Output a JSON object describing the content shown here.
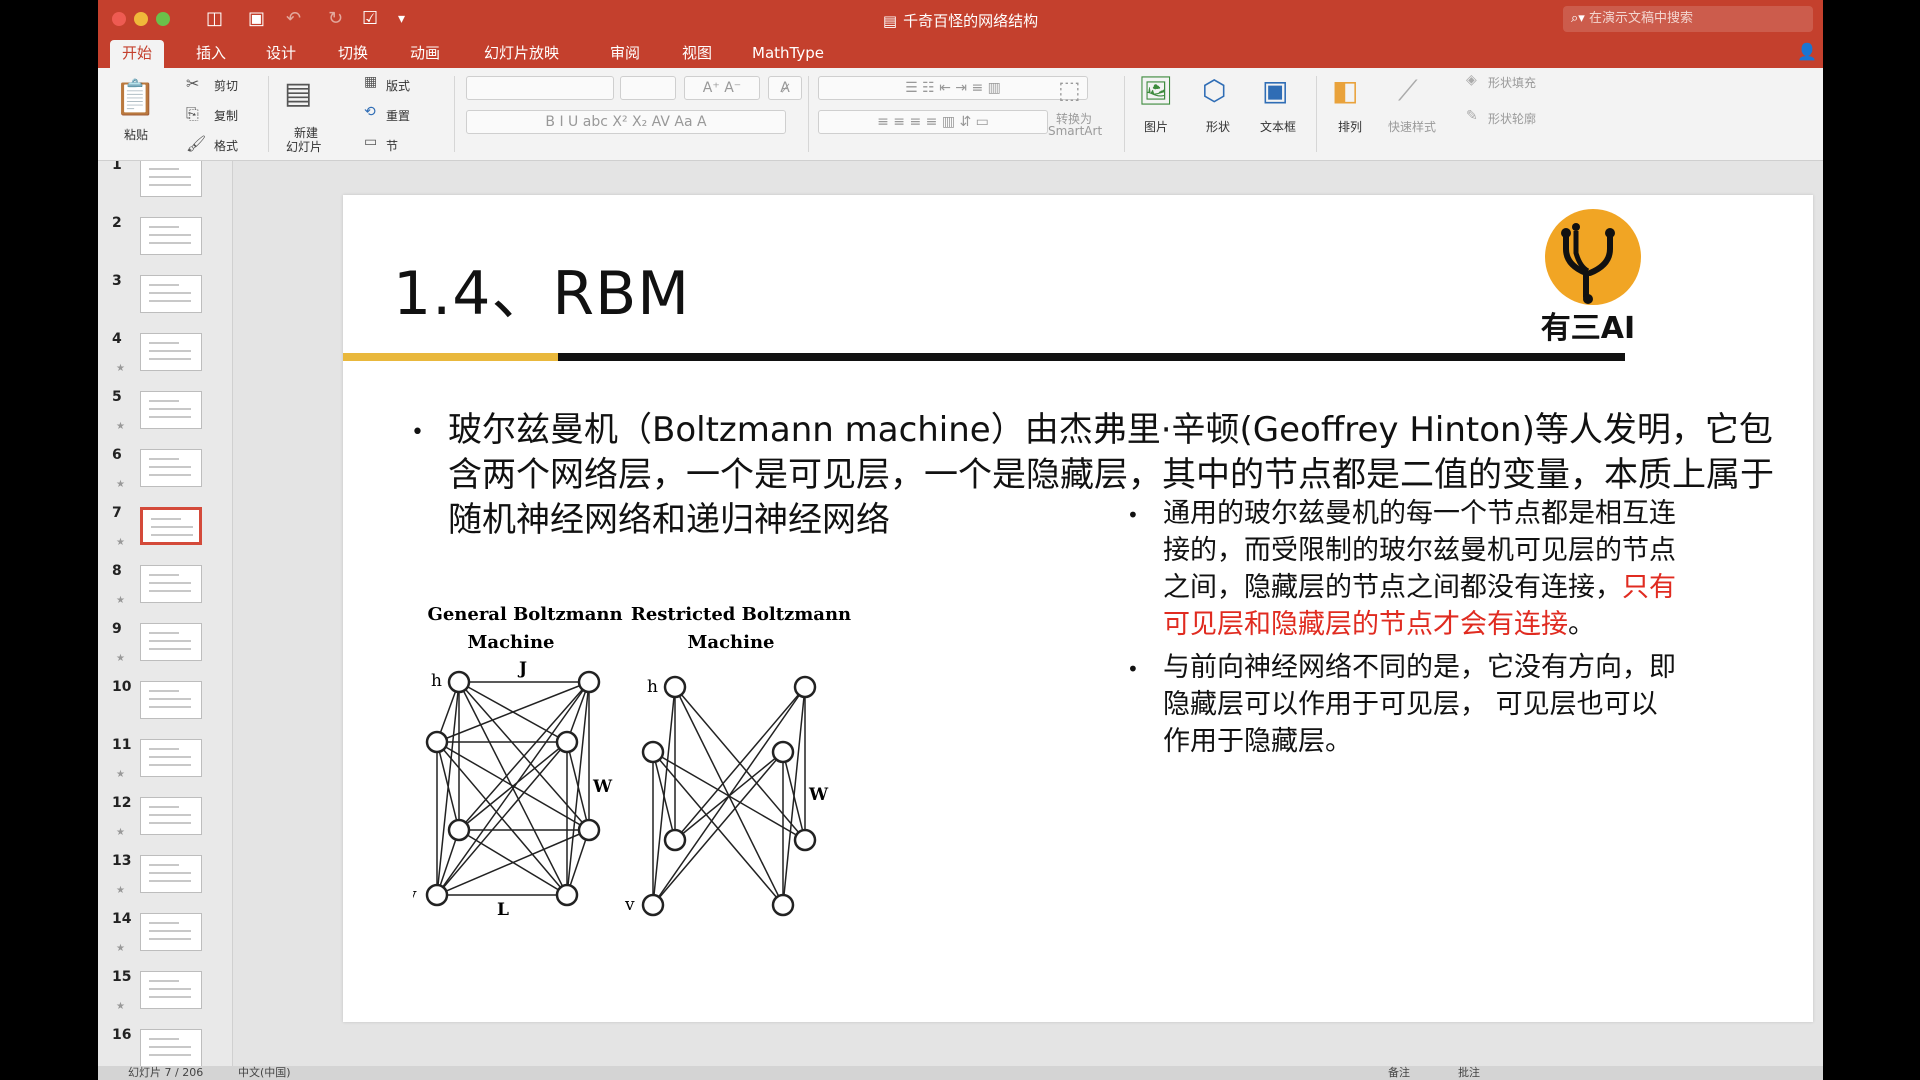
{
  "window": {
    "title": "千奇百怪的网络结构",
    "search_placeholder": "在演示文稿中搜索",
    "accent": "#c4402d"
  },
  "tabs": [
    {
      "label": "开始",
      "active": true
    },
    {
      "label": "插入"
    },
    {
      "label": "设计"
    },
    {
      "label": "切换"
    },
    {
      "label": "动画"
    },
    {
      "label": "幻灯片放映"
    },
    {
      "label": "审阅"
    },
    {
      "label": "视图"
    },
    {
      "label": "MathType"
    }
  ],
  "ribbon": {
    "paste": "粘贴",
    "cut": "剪切",
    "copy": "复制",
    "format": "格式",
    "new_slide_1": "新建",
    "new_slide_2": "幻灯片",
    "layout": "版式",
    "reset": "重置",
    "section": "节",
    "convert_1": "转换为",
    "convert_2": "SmartArt",
    "picture": "图片",
    "shape": "形状",
    "textbox": "文本框",
    "arrange": "排列",
    "quick_styles": "快速样式",
    "shape_fill": "形状填充",
    "shape_outline": "形状轮廓"
  },
  "thumbnails": [
    {
      "num": "1",
      "star": false
    },
    {
      "num": "2",
      "star": false
    },
    {
      "num": "3",
      "star": false
    },
    {
      "num": "4",
      "star": true
    },
    {
      "num": "5",
      "star": true
    },
    {
      "num": "6",
      "star": true
    },
    {
      "num": "7",
      "star": true,
      "selected": true
    },
    {
      "num": "8",
      "star": true
    },
    {
      "num": "9",
      "star": true
    },
    {
      "num": "10",
      "star": false
    },
    {
      "num": "11",
      "star": true
    },
    {
      "num": "12",
      "star": true
    },
    {
      "num": "13",
      "star": true
    },
    {
      "num": "14",
      "star": true
    },
    {
      "num": "15",
      "star": true
    },
    {
      "num": "16",
      "star": false
    }
  ],
  "slide": {
    "title": "1.4、RBM",
    "logo_text": "有三AI",
    "main_text": "玻尔兹曼机（Boltzmann machine）由杰弗里·辛顿(Geoffrey Hinton)等人发明，它包含两个网络层，一个是可见层，一个是隐藏层，其中的节点都是二值的变量，本质上属于随机神经网络和递归神经网络",
    "side_1_black": "通用的玻尔兹曼机的每一个节点都是相互连接的，而受限制的玻尔兹曼机可见层的节点之间，隐藏层的节点之间都没有连接，",
    "side_1_red": "只有可见层和隐藏层的节点才会有连接",
    "side_1_end": "。",
    "side_2": "与前向神经网络不同的是，它没有方向，即隐藏层可以作用于可见层， 可见层也可以作用于隐藏层。",
    "diagram": {
      "general_title_1": "General Boltzmann",
      "general_title_2": "Machine",
      "restricted_title_1": "Restricted Boltzmann",
      "restricted_title_2": "Machine",
      "h": "h",
      "v": "v",
      "j": "J",
      "l": "L",
      "w": "W"
    },
    "red_color": "#e02b20",
    "bar_yellow": "#e9b83c"
  },
  "status": {
    "left": "幻灯片 7 / 206",
    "lang": "中文(中国)",
    "notes": "备注",
    "comments": "批注"
  }
}
